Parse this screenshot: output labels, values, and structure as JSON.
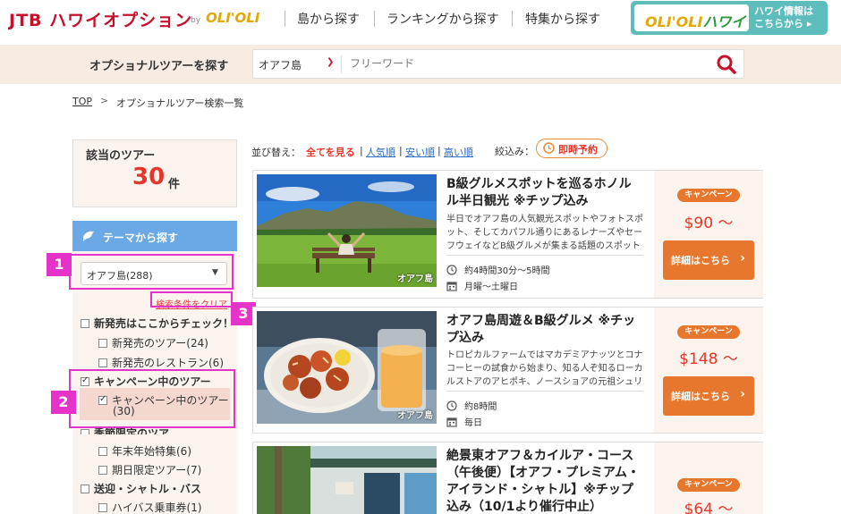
{
  "header": {
    "logo_main": "JTB ハワイオプション",
    "logo_by": "by",
    "logo_brand": "OLI'OLI",
    "nav": [
      "島から探す",
      "ランキングから探す",
      "特集から探す"
    ],
    "banner_logo": "OLI'OLI",
    "banner_logo_sub": "ハワイ",
    "banner_text_1": "ハワイ情報は",
    "banner_text_2": "こちらから ▸"
  },
  "search": {
    "title": "オプショナルツアーを探す",
    "area_value": "オアフ島",
    "free_word_placeholder": "フリーワード"
  },
  "breadcrumb": {
    "top": "TOP",
    "separator": ">",
    "current": "オプショナルツアー検索一覧"
  },
  "sidebar": {
    "count_label": "該当のツアー",
    "count_value": "30",
    "count_unit": "件",
    "theme_label": "テーマから探す",
    "area_dropdown": "オアフ島(288)",
    "clear_link": "検索条件をクリア",
    "filters": [
      {
        "label": "新発売はここからチェック！",
        "checked": false,
        "bold": true
      },
      {
        "label": "新発売のツアー(24)",
        "checked": false,
        "bold": false
      },
      {
        "label": "新発売のレストラン(6)",
        "checked": false,
        "bold": false
      },
      {
        "label": "キャンペーン中のツアー",
        "checked": true,
        "bold": true
      },
      {
        "label": "キャンペーン中のツアー",
        "checked": true,
        "bold": false
      },
      {
        "label": "(30)",
        "checked": false,
        "bold": false
      },
      {
        "label": "季節限定のツア",
        "checked": false,
        "bold": true
      },
      {
        "label": "年末年始特集(6)",
        "checked": false,
        "bold": false
      },
      {
        "label": "期日限定ツアー(7)",
        "checked": false,
        "bold": false
      },
      {
        "label": "送迎・シャトル・バス",
        "checked": false,
        "bold": true
      },
      {
        "label": "ハイバス乗車券(1)",
        "checked": false,
        "bold": false
      }
    ]
  },
  "callouts": [
    "1",
    "2",
    "3"
  ],
  "sort": {
    "label": "並び替え：",
    "options": [
      "全てを見る",
      "人気順",
      "安い順",
      "高い順"
    ],
    "separator": "|",
    "filter_label": "絞込み：",
    "instant_label": "即時予約"
  },
  "tours": [
    {
      "title": "B級グルメスポットを巡るホノルル半日観光 ※チップ込み",
      "description": "半日でオアフ島の人気観光スポットやフォトスポット、そしてカパフル通りにあるレナーズやセーフウェイなどB級グルメが集まる話題のスポットを訪...",
      "duration": "約4時間30分～5時間",
      "days": "月曜～土曜日",
      "photo_tag": "オアフ島",
      "campaign": "キャンペーン",
      "price": "$90 ～",
      "button": "詳細はこちら"
    },
    {
      "title": "オアフ島周遊＆B級グルメ ※チップ込み",
      "description": "トロピカルファームではマカデミアナッツとコナコーヒーの試食から始まり、知る人ぞ知るローカルストアのアヒポキ、ノースショアの元祖シュリンプ...",
      "duration": "約8時間",
      "days": "毎日",
      "photo_tag": "オアフ島",
      "campaign": "キャンペーン",
      "price": "$148 ～",
      "button": "詳細はこちら"
    },
    {
      "title": "絶景東オアフ＆カイルア・コース（午後便）【オアフ・プレミアム・アイランド・シャトル】※チップ込み（10/1より催行中止）",
      "campaign": "キャンペーン",
      "price": "$64 ～"
    }
  ],
  "colors": {
    "brand_red": "#c8102e",
    "accent_orange": "#e8772e",
    "price_red": "#e4362a",
    "theme_blue": "#6aa8e6",
    "callout_magenta": "#e533c9",
    "panel_beige": "#fbf3ed"
  }
}
